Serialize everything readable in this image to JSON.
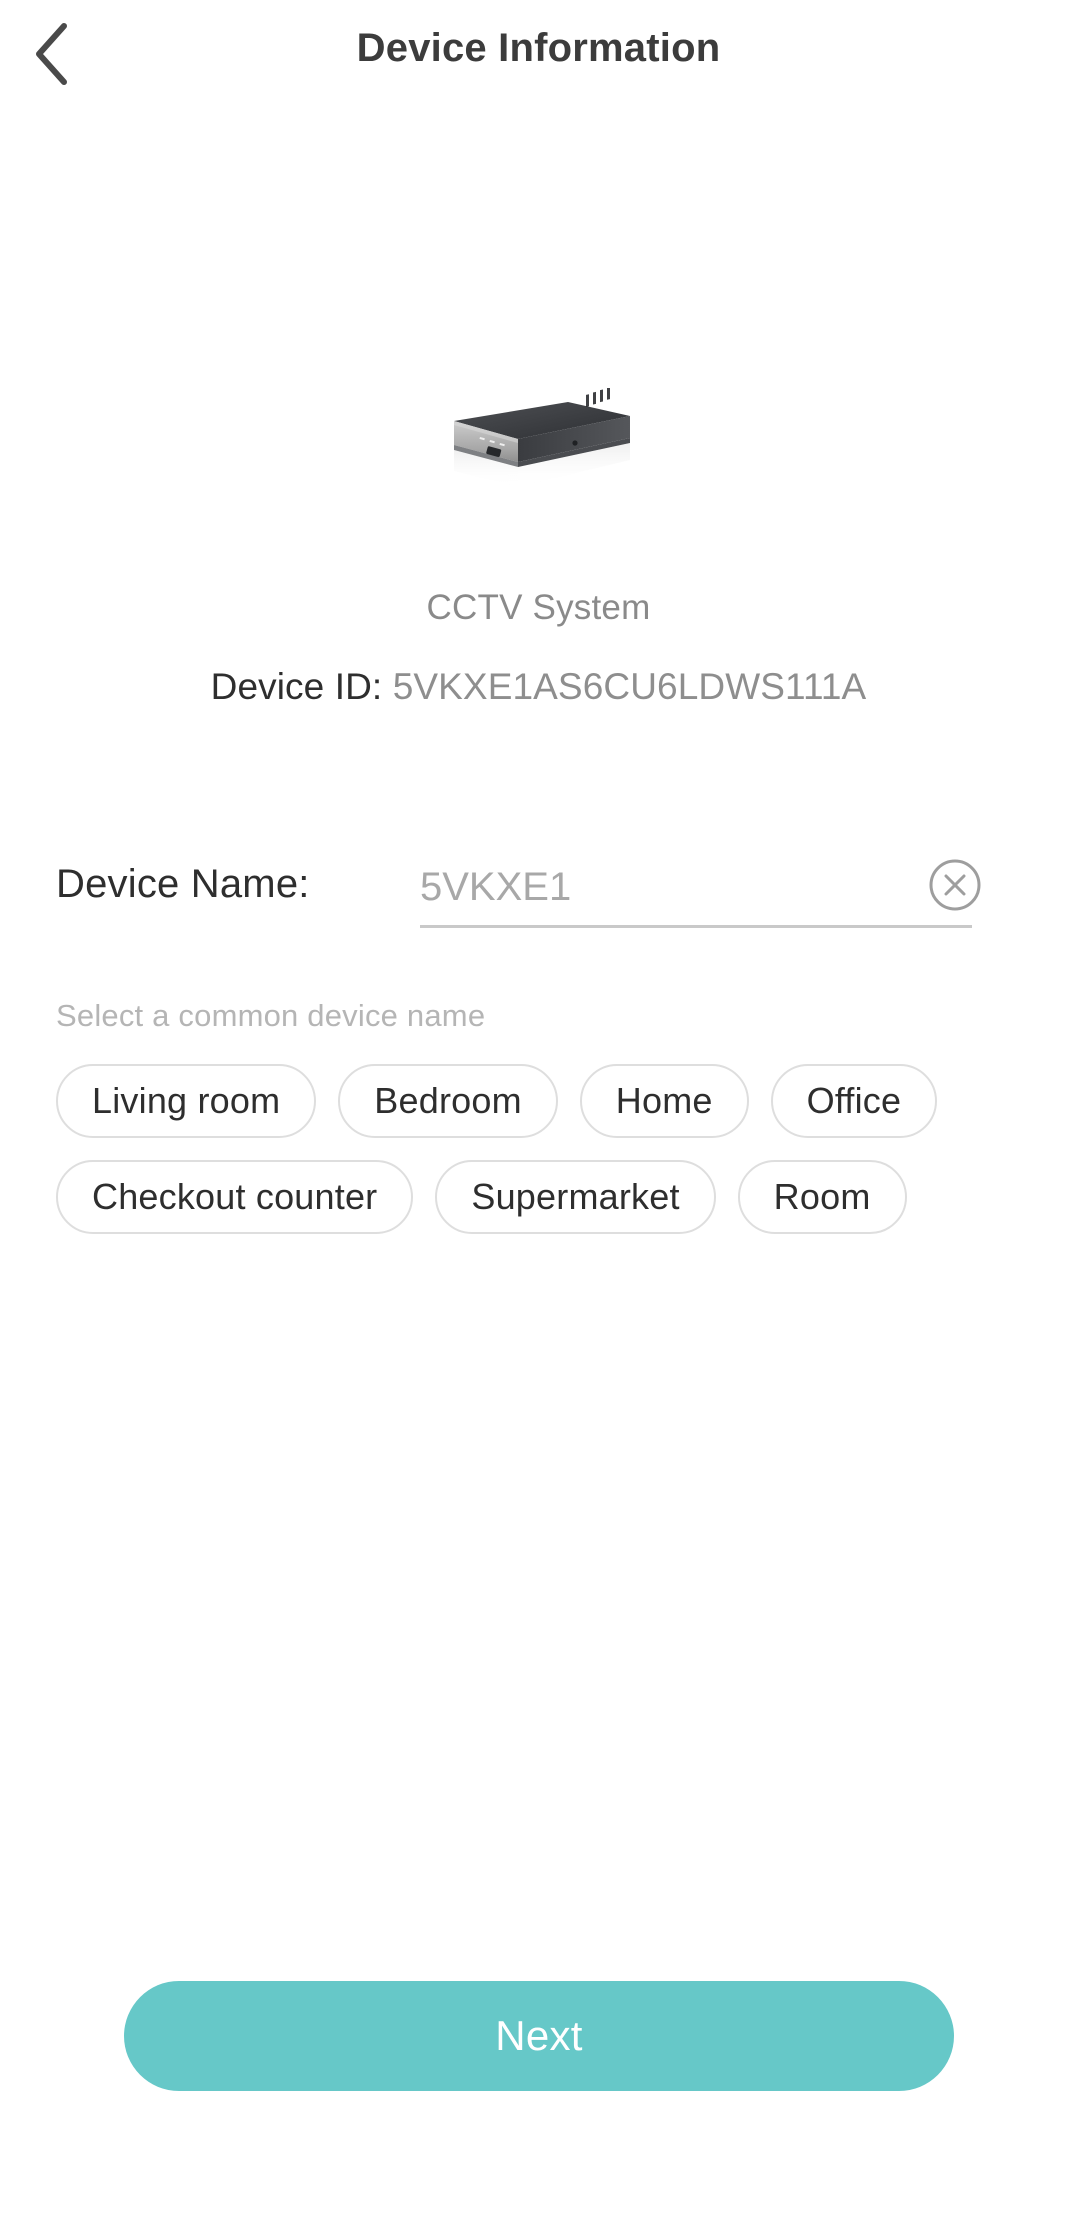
{
  "header": {
    "title": "Device Information",
    "back_icon": "chevron-left-icon"
  },
  "device": {
    "image_icon": "nvr-recorder-device-image",
    "type": "CCTV System",
    "id_label": "Device ID:",
    "id_value": "5VKXE1AS6CU6LDWS111A"
  },
  "form": {
    "name_label": "Device Name:",
    "name_value": "5VKXE1",
    "name_placeholder": "5VKXE1",
    "clear_icon": "clear-circle-x-icon",
    "hint": "Select a common device name",
    "suggestions": [
      "Living room",
      "Bedroom",
      "Home",
      "Office",
      "Checkout counter",
      "Supermarket",
      "Room"
    ]
  },
  "footer": {
    "next_label": "Next"
  },
  "colors": {
    "accent": "#66c8c8",
    "title": "#3c3c3c",
    "muted": "#8e8e8e",
    "hint": "#b5b5b5",
    "chip_border": "#dedede"
  }
}
